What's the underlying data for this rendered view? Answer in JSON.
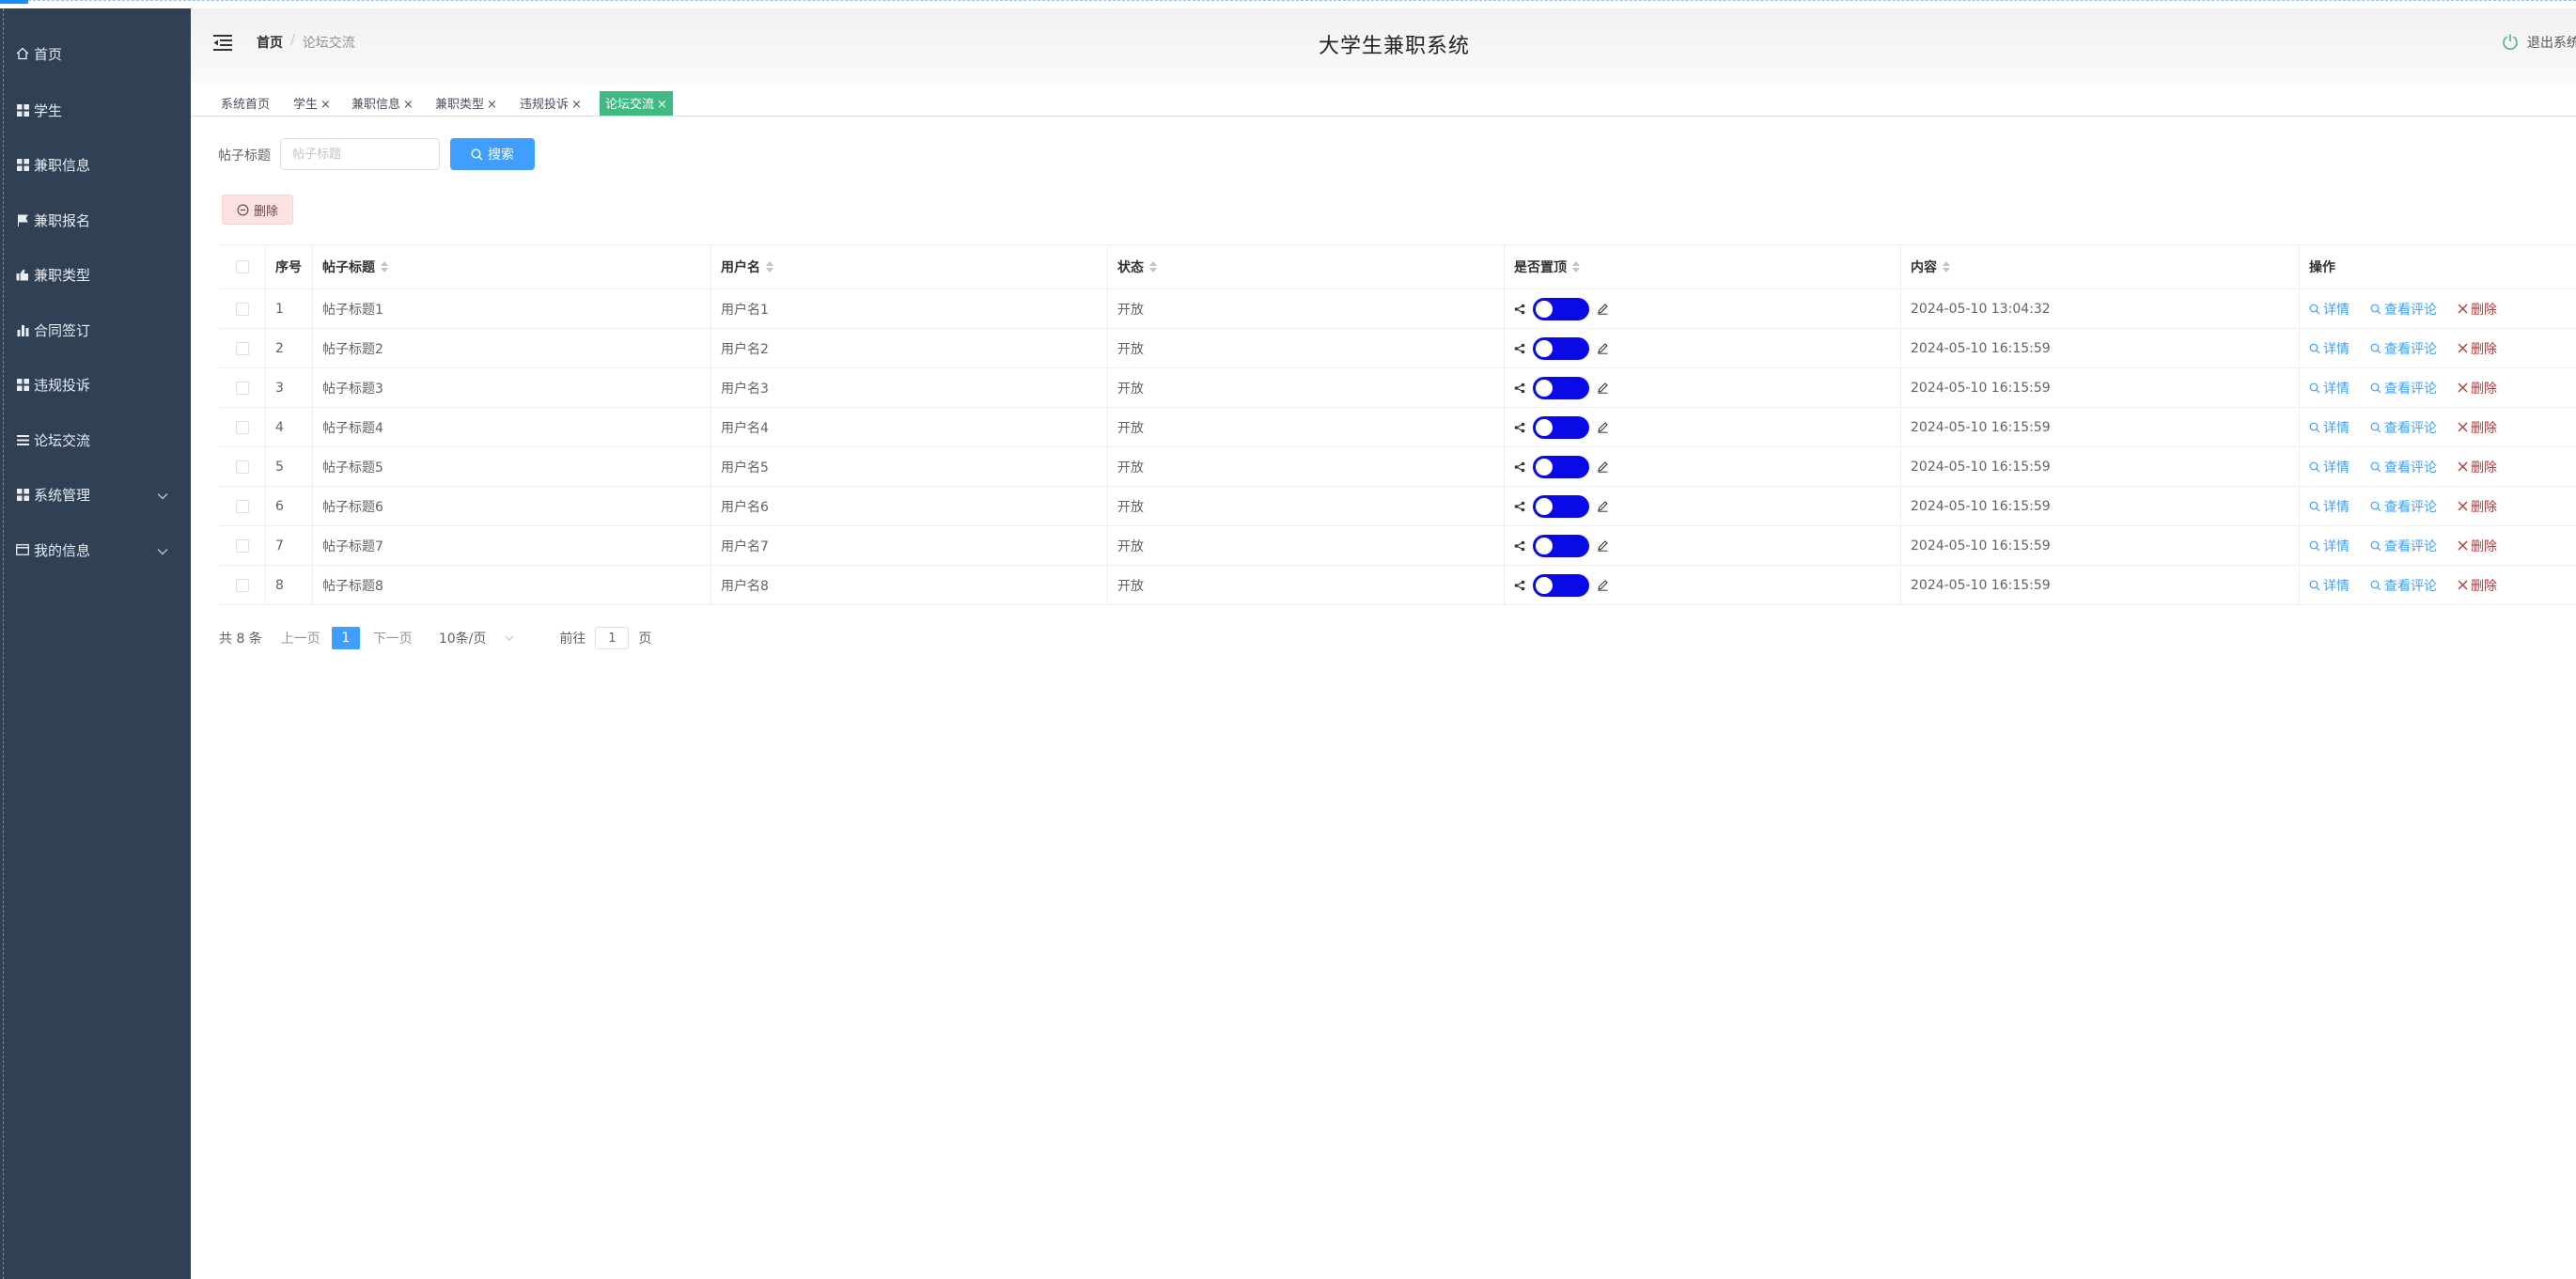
{
  "sidebar": {
    "items": [
      {
        "label": "首页",
        "icon": "home-icon"
      },
      {
        "label": "学生",
        "icon": "grid-icon"
      },
      {
        "label": "兼职信息",
        "icon": "grid-icon"
      },
      {
        "label": "兼职报名",
        "icon": "flag-icon"
      },
      {
        "label": "兼职类型",
        "icon": "thumb-icon"
      },
      {
        "label": "合同签订",
        "icon": "bar-chart-icon"
      },
      {
        "label": "违规投诉",
        "icon": "grid-icon"
      },
      {
        "label": "论坛交流",
        "icon": "list-icon"
      },
      {
        "label": "系统管理",
        "icon": "grid-icon"
      },
      {
        "label": "我的信息",
        "icon": "card-icon"
      }
    ]
  },
  "header": {
    "breadcrumb_home": "首页",
    "breadcrumb_sep": "/",
    "breadcrumb_current": "论坛交流",
    "title": "大学生兼职系统",
    "logout": "退出系统"
  },
  "tags": [
    {
      "label": "系统首页",
      "closable": false,
      "active": false
    },
    {
      "label": "学生",
      "closable": true,
      "active": false
    },
    {
      "label": "兼职信息",
      "closable": true,
      "active": false
    },
    {
      "label": "兼职类型",
      "closable": true,
      "active": false
    },
    {
      "label": "违规投诉",
      "closable": true,
      "active": false
    },
    {
      "label": "论坛交流",
      "closable": true,
      "active": true
    }
  ],
  "search": {
    "label": "帖子标题",
    "placeholder": "帖子标题",
    "button": "搜索"
  },
  "toolbar": {
    "delete": "删除"
  },
  "table": {
    "headers": {
      "index": "序号",
      "title": "帖子标题",
      "username": "用户名",
      "status": "状态",
      "top": "是否置顶",
      "content": "内容",
      "ops": "操作"
    },
    "ops": {
      "detail": "详情",
      "comments": "查看评论",
      "delete": "删除"
    },
    "rows": [
      {
        "index": "1",
        "title": "帖子标题1",
        "username": "用户名1",
        "status": "开放",
        "content": "2024-05-10 13:04:32"
      },
      {
        "index": "2",
        "title": "帖子标题2",
        "username": "用户名2",
        "status": "开放",
        "content": "2024-05-10 16:15:59"
      },
      {
        "index": "3",
        "title": "帖子标题3",
        "username": "用户名3",
        "status": "开放",
        "content": "2024-05-10 16:15:59"
      },
      {
        "index": "4",
        "title": "帖子标题4",
        "username": "用户名4",
        "status": "开放",
        "content": "2024-05-10 16:15:59"
      },
      {
        "index": "5",
        "title": "帖子标题5",
        "username": "用户名5",
        "status": "开放",
        "content": "2024-05-10 16:15:59"
      },
      {
        "index": "6",
        "title": "帖子标题6",
        "username": "用户名6",
        "status": "开放",
        "content": "2024-05-10 16:15:59"
      },
      {
        "index": "7",
        "title": "帖子标题7",
        "username": "用户名7",
        "status": "开放",
        "content": "2024-05-10 16:15:59"
      },
      {
        "index": "8",
        "title": "帖子标题8",
        "username": "用户名8",
        "status": "开放",
        "content": "2024-05-10 16:15:59"
      }
    ]
  },
  "pager": {
    "total": "共 8 条",
    "prev": "上一页",
    "page": "1",
    "next": "下一页",
    "size": "10条/页",
    "goto": "前往",
    "goto_value": "1",
    "page_suffix": "页"
  },
  "colors": {
    "sidebar": "#304156",
    "primary": "#409eff",
    "tag_active": "#42b983",
    "toggle": "#0a0ae6"
  }
}
